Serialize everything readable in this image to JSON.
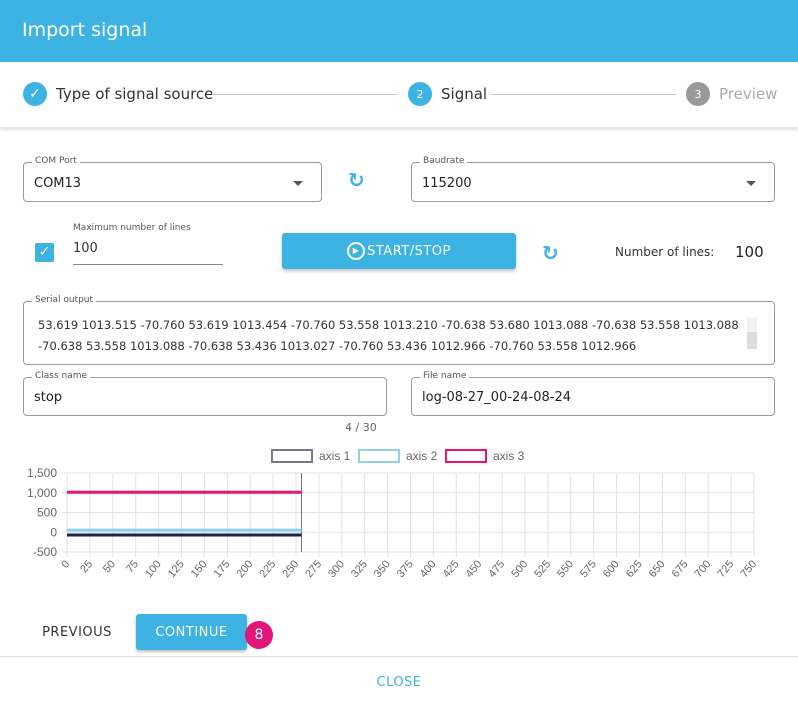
{
  "title": "Import signal",
  "steps": [
    {
      "num": "✓",
      "label": "Type of signal source"
    },
    {
      "num": "2",
      "label": "Signal"
    },
    {
      "num": "3",
      "label": "Preview"
    }
  ],
  "com_port": {
    "label": "COM Port",
    "value": "COM13"
  },
  "baudrate": {
    "label": "Baudrate",
    "value": "115200"
  },
  "max_lines": {
    "label": "Maximum number of lines",
    "value": "100"
  },
  "start_stop": "START/STOP",
  "num_lines": {
    "label": "Number of lines:",
    "value": "100"
  },
  "serial": {
    "label": "Serial output",
    "line1": "53.619 1013.515 -70.760 53.619 1013.454 -70.760 53.558 1013.210 -70.638 53.680 1013.088 -70.638 53.558 1013.088",
    "line2": "-70.638 53.558 1013.088 -70.638 53.436 1013.027 -70.760 53.436 1012.966 -70.760 53.558 1012.966"
  },
  "class_name": {
    "label": "Class name",
    "value": "stop",
    "counter": "4 / 30"
  },
  "file_name": {
    "label": "File name",
    "value": "log-08-27_00-24-08-24"
  },
  "chart_data": {
    "type": "line",
    "legend": [
      "axis 1",
      "axis 2",
      "axis 3"
    ],
    "colors": [
      "#1a1f4e",
      "#8fd0ec",
      "#f0126f"
    ],
    "series": [
      {
        "name": "axis 1",
        "x": [
          0,
          256
        ],
        "values": [
          -70.7,
          -70.7
        ]
      },
      {
        "name": "axis 2",
        "x": [
          0,
          256
        ],
        "values": [
          53.5,
          53.5
        ]
      },
      {
        "name": "axis 3",
        "x": [
          0,
          256
        ],
        "values": [
          1013,
          1013
        ]
      }
    ],
    "xlim": [
      0,
      750
    ],
    "ylim": [
      -500,
      1500
    ],
    "xticks": [
      0,
      25,
      50,
      75,
      100,
      125,
      150,
      175,
      200,
      225,
      250,
      275,
      300,
      325,
      350,
      375,
      400,
      425,
      450,
      475,
      500,
      525,
      550,
      575,
      600,
      625,
      650,
      675,
      700,
      725,
      750
    ],
    "yticks": [
      "1,500",
      "1,000",
      "500",
      "0",
      "-500"
    ],
    "yvals": [
      1500,
      1000,
      500,
      0,
      -500
    ],
    "cursor_x": 256
  },
  "buttons": {
    "previous": "PREVIOUS",
    "continue": "CONTINUE",
    "badge": "8",
    "close": "CLOSE"
  }
}
